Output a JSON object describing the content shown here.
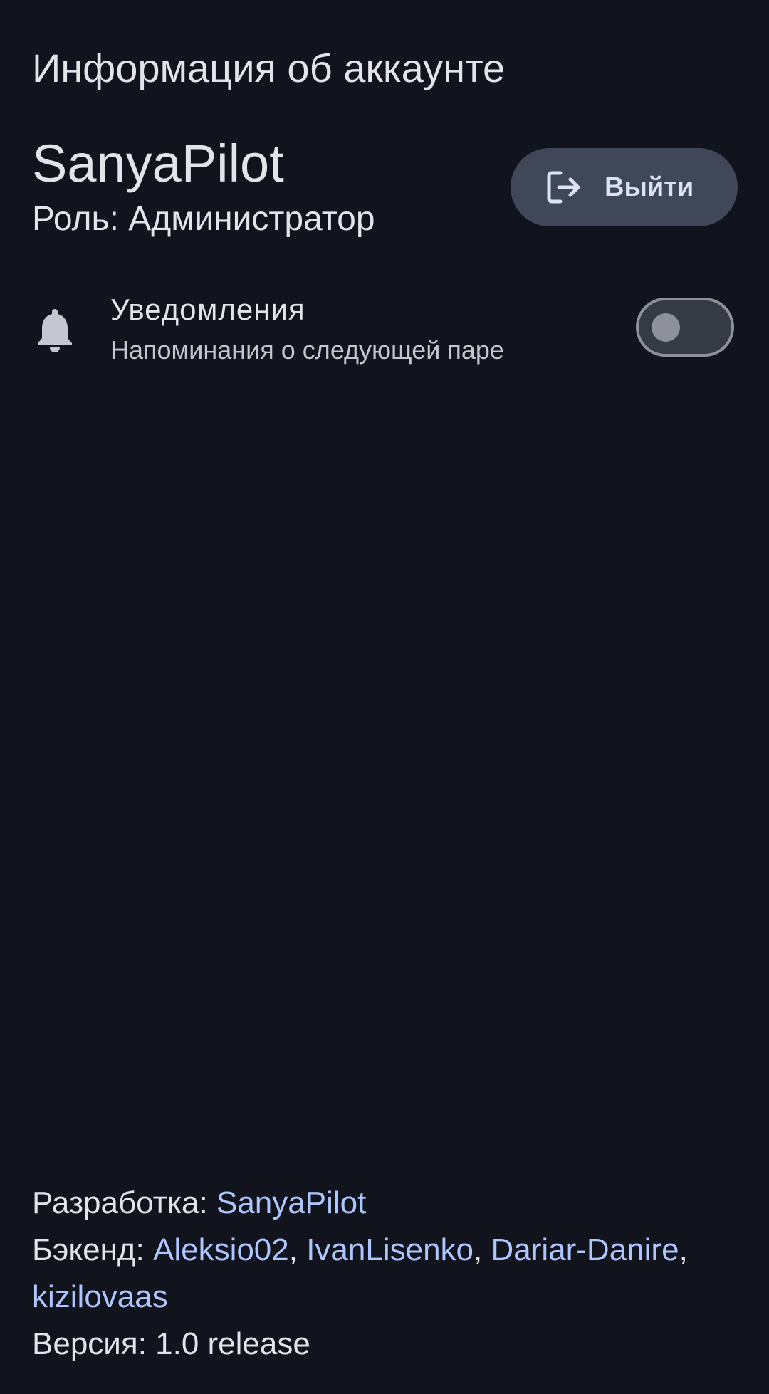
{
  "header": {
    "title": "Информация об аккаунте"
  },
  "account": {
    "username": "SanyaPilot",
    "role": "Роль: Администратор",
    "logout_label": "Выйти"
  },
  "notifications": {
    "title": "Уведомления",
    "subtitle": "Напоминания о следующей паре",
    "enabled": false
  },
  "footer": {
    "development_label": "Разработка: ",
    "developer": "SanyaPilot",
    "backend_label": "Бэкенд: ",
    "backend_devs": [
      "Aleksio02",
      "IvanLisenko",
      "Dariar-Danire",
      "kizilovaas"
    ],
    "separator": ", ",
    "version_text": "Версия: 1.0 release"
  },
  "colors": {
    "background": "#11141c",
    "button_bg": "#3f4759",
    "link": "#aec6ff",
    "text": "#e3e3ea",
    "toggle_outline": "#8e909a"
  },
  "icons": {
    "logout": "logout-icon",
    "notifications": "bell-icon"
  }
}
